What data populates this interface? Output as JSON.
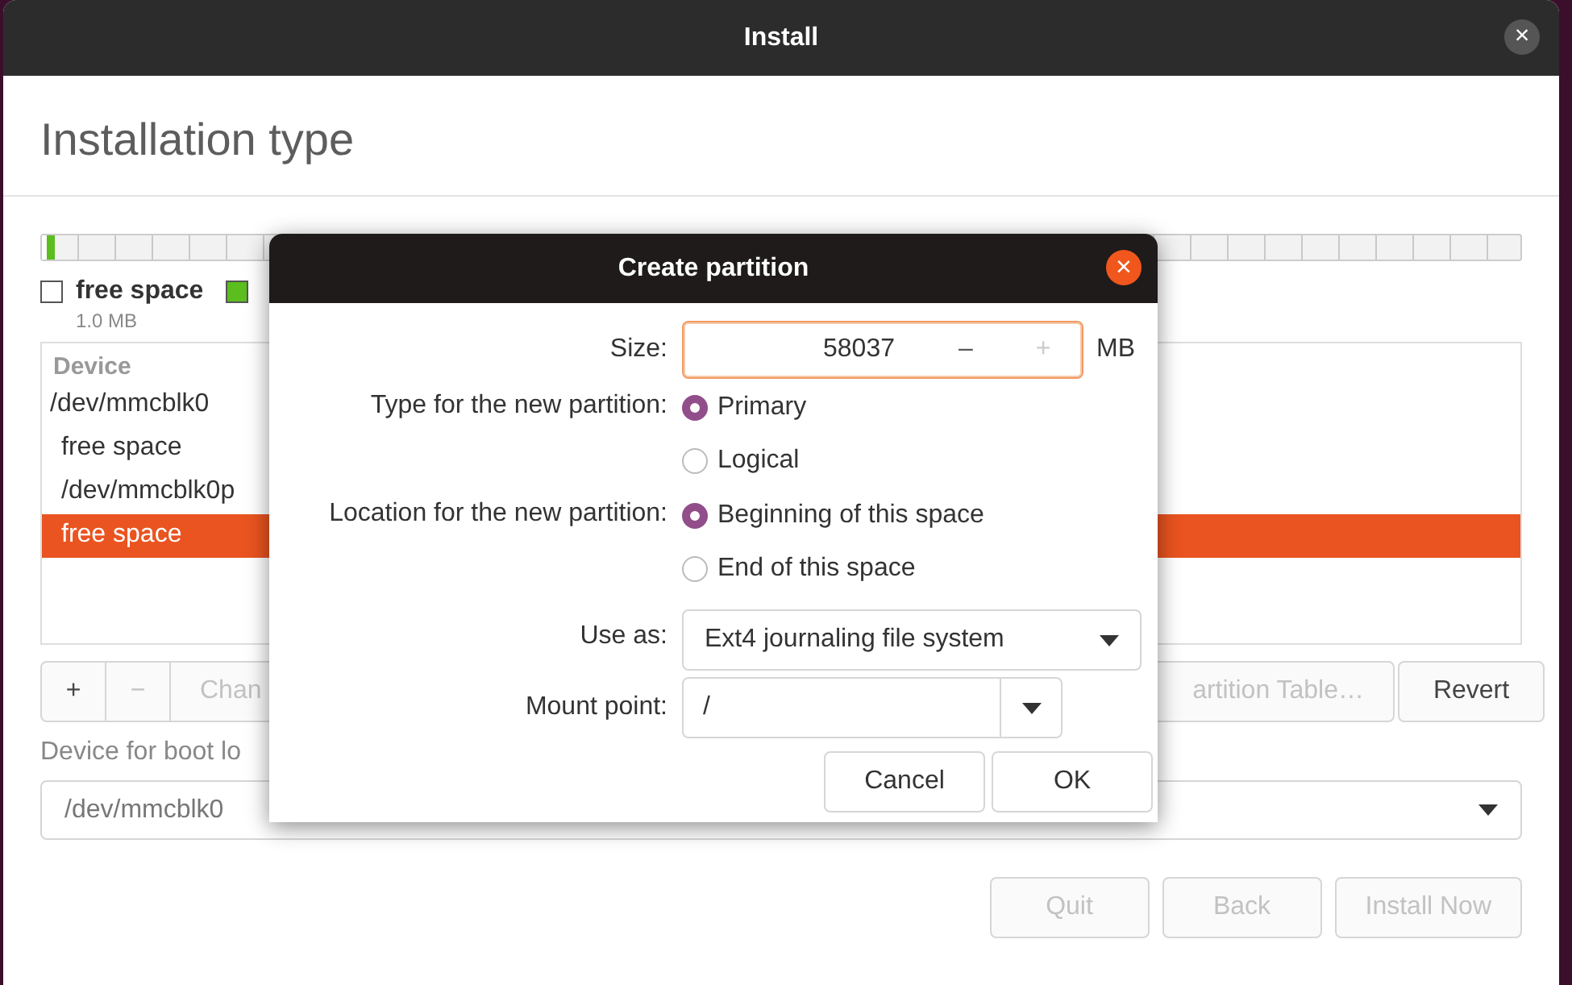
{
  "window": {
    "title": "Install",
    "close": "×"
  },
  "heading": "Installation type",
  "legend": [
    {
      "label": "free space",
      "size": "1.0 MB",
      "color": "#ffffff"
    },
    {
      "color": "#5bbd1e"
    }
  ],
  "device_table": {
    "header": "Device",
    "rows": [
      {
        "text": "/dev/mmcblk0",
        "selected": false,
        "children": [
          {
            "text": "free space",
            "selected": false
          },
          {
            "text": "/dev/mmcblk0p",
            "selected": false
          },
          {
            "text": "free space",
            "selected": true
          }
        ]
      }
    ]
  },
  "tool_buttons": [
    {
      "label": "+",
      "disabled": false
    },
    {
      "label": "−",
      "disabled": true
    },
    {
      "label": "Chan",
      "disabled": true
    }
  ],
  "right_buttons": [
    {
      "label": "artition Table…",
      "disabled": true
    },
    {
      "label": "Revert",
      "disabled": false
    }
  ],
  "boot_loader": {
    "label": "Device for boot lo",
    "device": "/dev/mmcblk0"
  },
  "footer_buttons": [
    {
      "label": "Quit",
      "disabled": true
    },
    {
      "label": "Back",
      "disabled": true
    },
    {
      "label": "Install Now",
      "disabled": true
    }
  ],
  "dialog": {
    "title": "Create partition",
    "close": "×",
    "size": {
      "label": "Size:",
      "value": "58037",
      "minus": "–",
      "plus": "+",
      "plus_disabled": true,
      "unit": "MB"
    },
    "radio_groups": [
      {
        "label": "Type for the new partition:",
        "options": [
          {
            "label": "Primary",
            "selected": true
          },
          {
            "label": "Logical",
            "selected": false
          }
        ]
      },
      {
        "label": "Location for the new partition:",
        "options": [
          {
            "label": "Beginning of this space",
            "selected": true
          },
          {
            "label": "End of this space",
            "selected": false
          }
        ]
      }
    ],
    "use_as": {
      "label": "Use as:",
      "value": "Ext4 journaling file system"
    },
    "mount_point": {
      "label": "Mount point:",
      "value": "/"
    },
    "buttons": [
      "Cancel",
      "OK"
    ]
  }
}
